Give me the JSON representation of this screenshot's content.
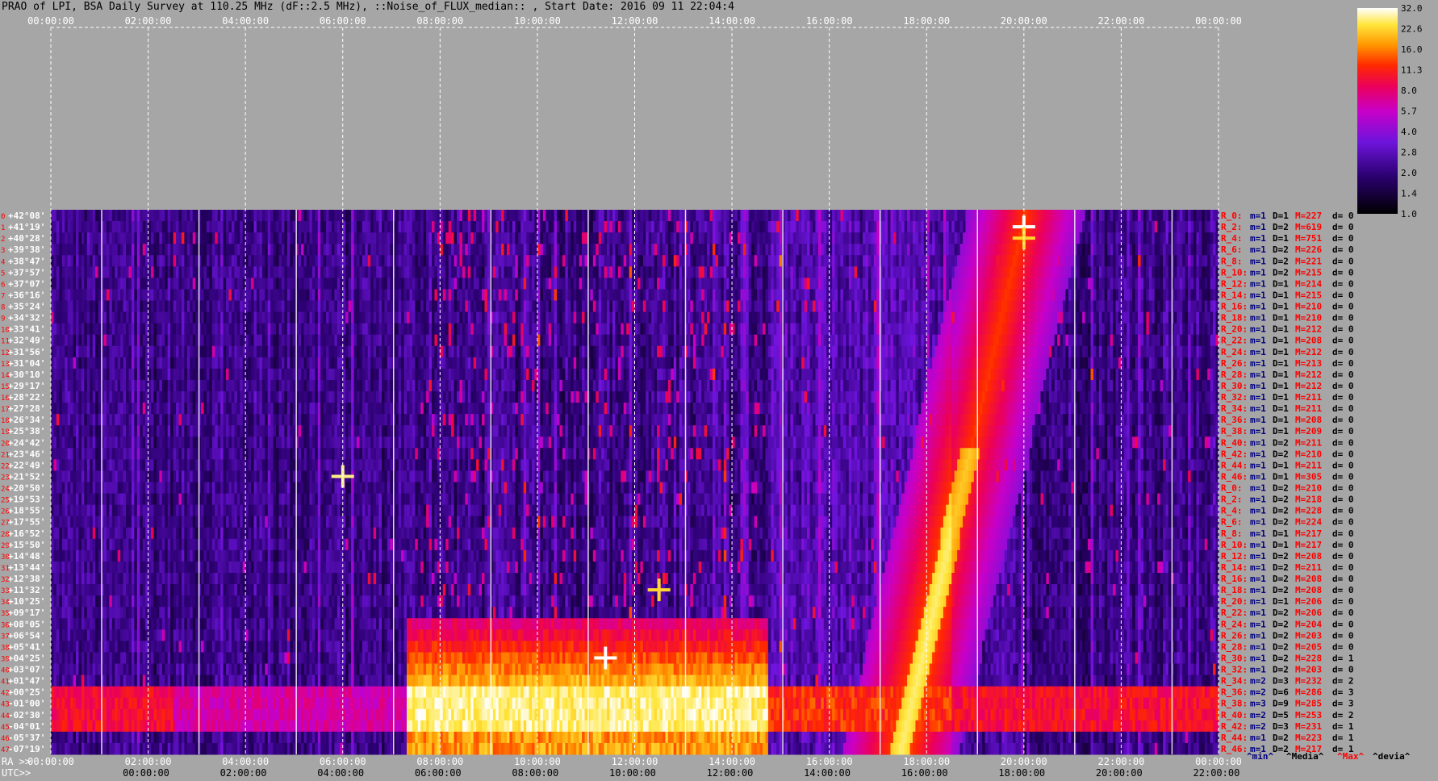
{
  "title": "PRAO of LPI, BSA Daily Survey at 110.25 MHz (dF::2.5 MHz), ::Noise_of_FLUX_median:: , Start Date: 2016 09 11 22:04:4",
  "chart_data": {
    "type": "heatmap",
    "top_axis_ticks": [
      "00:00:00",
      "02:00:00",
      "04:00:00",
      "06:00:00",
      "08:00:00",
      "10:00:00",
      "12:00:00",
      "14:00:00",
      "16:00:00",
      "18:00:00",
      "20:00:00",
      "22:00:00",
      "00:00:00"
    ],
    "ra_axis_label": "RA >>",
    "ra_axis_ticks": [
      "00:00:00",
      "02:00:00",
      "04:00:00",
      "06:00:00",
      "08:00:00",
      "10:00:00",
      "12:00:00",
      "14:00:00",
      "16:00:00",
      "18:00:00",
      "20:00:00",
      "22:00:00",
      "00:00:00"
    ],
    "utc_axis_label": "UTC>>",
    "utc_axis_ticks": [
      "00:00:00",
      "02:00:00",
      "04:00:00",
      "06:00:00",
      "08:00:00",
      "10:00:00",
      "12:00:00",
      "14:00:00",
      "16:00:00",
      "18:00:00",
      "20:00:00",
      "22:00:00"
    ],
    "colorbar_ticks": [
      "32.0",
      "22.6",
      "16.0",
      "11.3",
      "8.0",
      "5.7",
      "4.0",
      "2.8",
      "2.0",
      "1.4",
      "1.0"
    ],
    "declinations": [
      "+42°08'",
      "+41°19'",
      "+40°28'",
      "+39°38'",
      "+38°47'",
      "+37°57'",
      "+37°07'",
      "+36°16'",
      "+35°24'",
      "+34°32'",
      "+33°41'",
      "+32°49'",
      "+31°56'",
      "+31°04'",
      "+30°10'",
      "+29°17'",
      "+28°22'",
      "+27°28'",
      "+26°34'",
      "+25°38'",
      "+24°42'",
      "+23°46'",
      "+22°49'",
      "+21°52'",
      "+20°50'",
      "+19°53'",
      "+18°55'",
      "+17°55'",
      "+16°52'",
      "+15°50'",
      "+14°48'",
      "+13°44'",
      "+12°38'",
      "+11°32'",
      "+10°25'",
      "+09°17'",
      "+08°05'",
      "+06°54'",
      "+05°41'",
      "+04°25'",
      "+03°07'",
      "+01°47'",
      "+00°25'",
      "-01°00'",
      "-02°30'",
      "-04°01'",
      "-05°37'",
      "-07°19'"
    ],
    "row_indices": [
      "0",
      "1",
      "2",
      "3",
      "4",
      "5",
      "6",
      "7",
      "8",
      "9",
      "10",
      "11",
      "12",
      "13",
      "14",
      "15",
      "16",
      "17",
      "18",
      "19",
      "20",
      "21",
      "22",
      "23",
      "24",
      "25",
      "26",
      "27",
      "28",
      "29",
      "30",
      "31",
      "32",
      "33",
      "34",
      "35",
      "36",
      "37",
      "38",
      "39",
      "40",
      "41",
      "42",
      "43",
      "44",
      "45",
      "46",
      "47"
    ],
    "row_stats": [
      {
        "r": "R_0:",
        "m": "m=1",
        "D": "D=1",
        "M": "M=227",
        "d": "d= 0"
      },
      {
        "r": "R_2:",
        "m": "m=1",
        "D": "D=2",
        "M": "M=619",
        "d": "d= 0"
      },
      {
        "r": "R_4:",
        "m": "m=1",
        "D": "D=1",
        "M": "M=751",
        "d": "d= 0"
      },
      {
        "r": "R_6:",
        "m": "m=1",
        "D": "D=2",
        "M": "M=226",
        "d": "d= 0"
      },
      {
        "r": "R_8:",
        "m": "m=1",
        "D": "D=2",
        "M": "M=221",
        "d": "d= 0"
      },
      {
        "r": "R_10:",
        "m": "m=1",
        "D": "D=2",
        "M": "M=215",
        "d": "d= 0"
      },
      {
        "r": "R_12:",
        "m": "m=1",
        "D": "D=1",
        "M": "M=214",
        "d": "d= 0"
      },
      {
        "r": "R_14:",
        "m": "m=1",
        "D": "D=1",
        "M": "M=215",
        "d": "d= 0"
      },
      {
        "r": "R_16:",
        "m": "m=1",
        "D": "D=1",
        "M": "M=210",
        "d": "d= 0"
      },
      {
        "r": "R_18:",
        "m": "m=1",
        "D": "D=1",
        "M": "M=210",
        "d": "d= 0"
      },
      {
        "r": "R_20:",
        "m": "m=1",
        "D": "D=1",
        "M": "M=212",
        "d": "d= 0"
      },
      {
        "r": "R_22:",
        "m": "m=1",
        "D": "D=1",
        "M": "M=208",
        "d": "d= 0"
      },
      {
        "r": "R_24:",
        "m": "m=1",
        "D": "D=1",
        "M": "M=212",
        "d": "d= 0"
      },
      {
        "r": "R_26:",
        "m": "m=1",
        "D": "D=1",
        "M": "M=213",
        "d": "d= 0"
      },
      {
        "r": "R_28:",
        "m": "m=1",
        "D": "D=1",
        "M": "M=212",
        "d": "d= 0"
      },
      {
        "r": "R_30:",
        "m": "m=1",
        "D": "D=1",
        "M": "M=212",
        "d": "d= 0"
      },
      {
        "r": "R_32:",
        "m": "m=1",
        "D": "D=1",
        "M": "M=211",
        "d": "d= 0"
      },
      {
        "r": "R_34:",
        "m": "m=1",
        "D": "D=1",
        "M": "M=211",
        "d": "d= 0"
      },
      {
        "r": "R_36:",
        "m": "m=1",
        "D": "D=1",
        "M": "M=208",
        "d": "d= 0"
      },
      {
        "r": "R_38:",
        "m": "m=1",
        "D": "D=1",
        "M": "M=209",
        "d": "d= 0"
      },
      {
        "r": "R_40:",
        "m": "m=1",
        "D": "D=2",
        "M": "M=211",
        "d": "d= 0"
      },
      {
        "r": "R_42:",
        "m": "m=1",
        "D": "D=2",
        "M": "M=210",
        "d": "d= 0"
      },
      {
        "r": "R_44:",
        "m": "m=1",
        "D": "D=1",
        "M": "M=211",
        "d": "d= 0"
      },
      {
        "r": "R_46:",
        "m": "m=1",
        "D": "D=1",
        "M": "M=305",
        "d": "d= 0"
      },
      {
        "r": "R_0:",
        "m": "m=1",
        "D": "D=2",
        "M": "M=210",
        "d": "d= 0"
      },
      {
        "r": "R_2:",
        "m": "m=1",
        "D": "D=2",
        "M": "M=218",
        "d": "d= 0"
      },
      {
        "r": "R_4:",
        "m": "m=1",
        "D": "D=2",
        "M": "M=228",
        "d": "d= 0"
      },
      {
        "r": "R_6:",
        "m": "m=1",
        "D": "D=2",
        "M": "M=224",
        "d": "d= 0"
      },
      {
        "r": "R_8:",
        "m": "m=1",
        "D": "D=1",
        "M": "M=217",
        "d": "d= 0"
      },
      {
        "r": "R_10:",
        "m": "m=1",
        "D": "D=1",
        "M": "M=217",
        "d": "d= 0"
      },
      {
        "r": "R_12:",
        "m": "m=1",
        "D": "D=2",
        "M": "M=208",
        "d": "d= 0"
      },
      {
        "r": "R_14:",
        "m": "m=1",
        "D": "D=2",
        "M": "M=211",
        "d": "d= 0"
      },
      {
        "r": "R_16:",
        "m": "m=1",
        "D": "D=2",
        "M": "M=208",
        "d": "d= 0"
      },
      {
        "r": "R_18:",
        "m": "m=1",
        "D": "D=2",
        "M": "M=208",
        "d": "d= 0"
      },
      {
        "r": "R_20:",
        "m": "m=1",
        "D": "D=1",
        "M": "M=206",
        "d": "d= 0"
      },
      {
        "r": "R_22:",
        "m": "m=1",
        "D": "D=2",
        "M": "M=206",
        "d": "d= 0"
      },
      {
        "r": "R_24:",
        "m": "m=1",
        "D": "D=2",
        "M": "M=204",
        "d": "d= 0"
      },
      {
        "r": "R_26:",
        "m": "m=1",
        "D": "D=2",
        "M": "M=203",
        "d": "d= 0"
      },
      {
        "r": "R_28:",
        "m": "m=1",
        "D": "D=2",
        "M": "M=205",
        "d": "d= 0"
      },
      {
        "r": "R_30:",
        "m": "m=1",
        "D": "D=2",
        "M": "M=228",
        "d": "d= 1"
      },
      {
        "r": "R_32:",
        "m": "m=1",
        "D": "D=2",
        "M": "M=203",
        "d": "d= 0"
      },
      {
        "r": "R_34:",
        "m": "m=2",
        "D": "D=3",
        "M": "M=232",
        "d": "d= 2"
      },
      {
        "r": "R_36:",
        "m": "m=2",
        "D": "D=6",
        "M": "M=286",
        "d": "d= 3"
      },
      {
        "r": "R_38:",
        "m": "m=3",
        "D": "D=9",
        "M": "M=285",
        "d": "d= 3"
      },
      {
        "r": "R_40:",
        "m": "m=2",
        "D": "D=5",
        "M": "M=253",
        "d": "d= 2"
      },
      {
        "r": "R_42:",
        "m": "m=2",
        "D": "D=3",
        "M": "M=231",
        "d": "d= 1"
      },
      {
        "r": "R_44:",
        "m": "m=1",
        "D": "D=2",
        "M": "M=223",
        "d": "d= 1"
      },
      {
        "r": "R_46:",
        "m": "m=1",
        "D": "D=2",
        "M": "M=217",
        "d": "d= 1"
      }
    ],
    "stats_legend": [
      "^min^",
      "^Media^",
      "^Max^",
      "^devia^"
    ],
    "colors": {
      "m": "#000080",
      "M": "#ff0000",
      "r": "#ff0000",
      "min": "#000080",
      "max": "#ff0000",
      "index": "#ff0000"
    }
  }
}
